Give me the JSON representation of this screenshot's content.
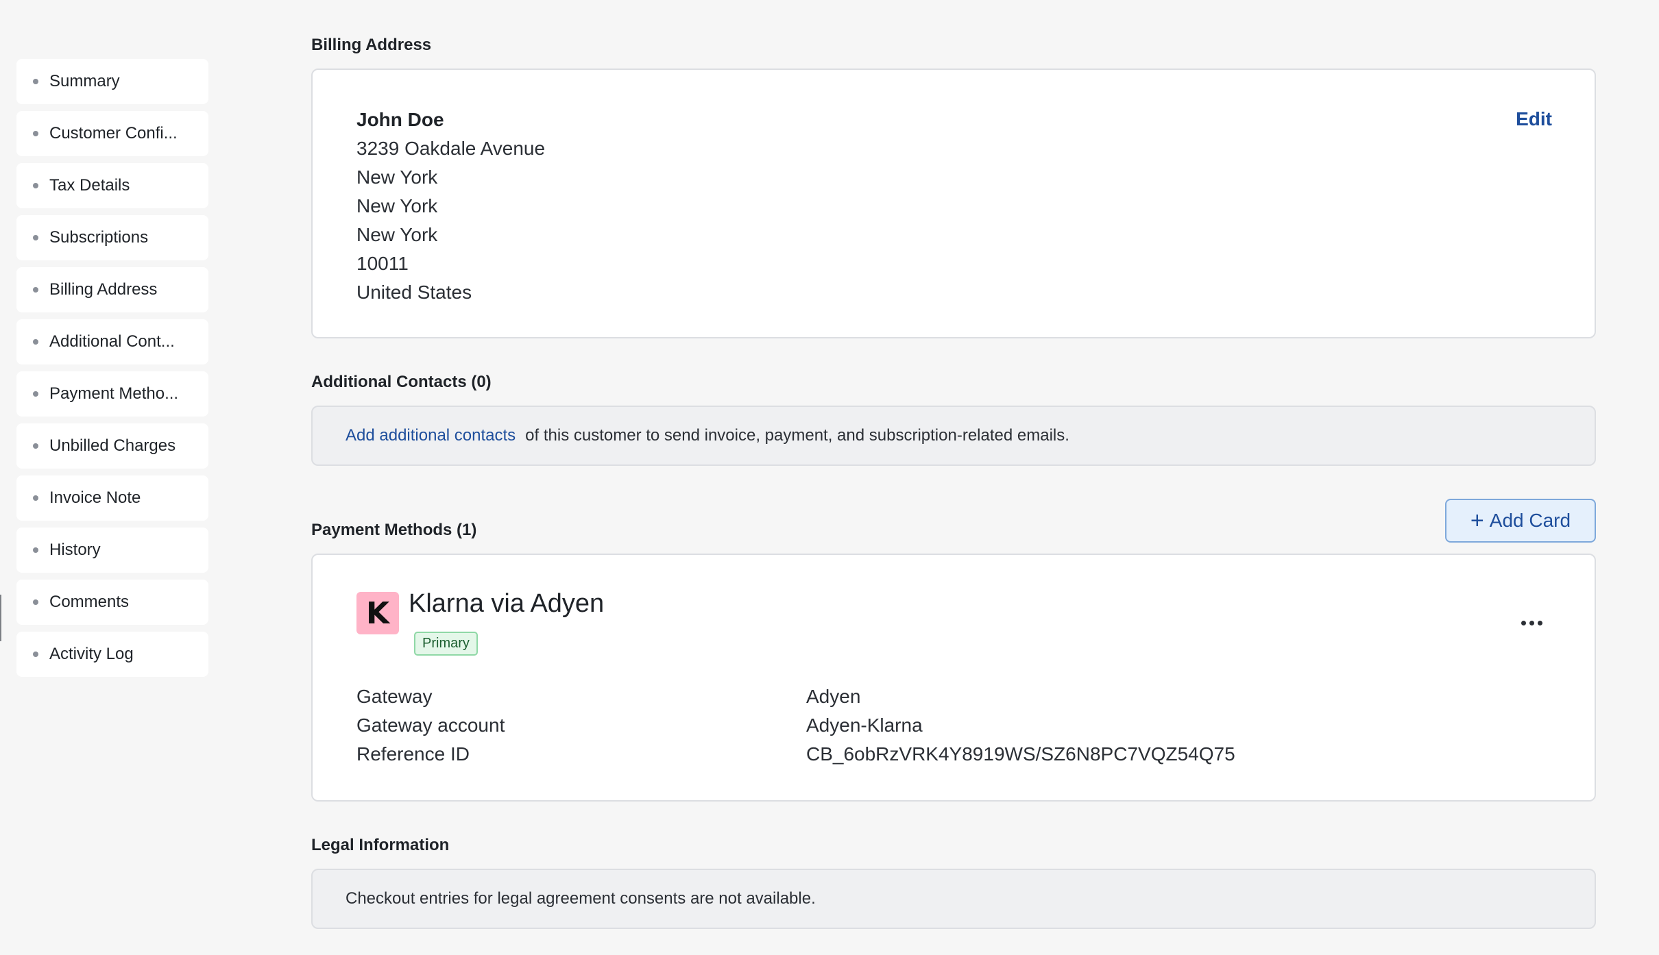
{
  "sidebar": {
    "items": [
      {
        "label": "Summary"
      },
      {
        "label": "Customer Confi..."
      },
      {
        "label": "Tax Details"
      },
      {
        "label": "Subscriptions"
      },
      {
        "label": "Billing Address"
      },
      {
        "label": "Additional Cont..."
      },
      {
        "label": "Payment Metho..."
      },
      {
        "label": "Unbilled Charges"
      },
      {
        "label": "Invoice Note"
      },
      {
        "label": "History"
      },
      {
        "label": "Comments"
      },
      {
        "label": "Activity Log"
      }
    ]
  },
  "billing_address": {
    "title": "Billing Address",
    "edit_label": "Edit",
    "name": "John Doe",
    "lines": [
      "3239 Oakdale Avenue",
      "New York",
      "New York",
      "New York",
      "10011",
      "United States"
    ]
  },
  "additional_contacts": {
    "title": "Additional Contacts (0)",
    "link_text": "Add additional contacts",
    "text": "of this customer to send invoice, payment, and subscription-related emails."
  },
  "payment_methods": {
    "title": "Payment Methods (1)",
    "add_card_label": "Add Card",
    "method": {
      "logo_letter": "K",
      "name": "Klarna via Adyen",
      "badge": "Primary",
      "rows": [
        {
          "key": "Gateway",
          "value": "Adyen"
        },
        {
          "key": "Gateway account",
          "value": "Adyen-Klarna"
        },
        {
          "key": "Reference ID",
          "value": "CB_6obRzVRK4Y8919WS/SZ6N8PC7VQZ54Q75"
        }
      ]
    }
  },
  "legal_information": {
    "title": "Legal Information",
    "text": "Checkout entries for legal agreement consents are not available."
  },
  "colors": {
    "accent": "#1e4e9c",
    "klarna_pink": "#ffb3c7",
    "badge_green": "#1b5e2f"
  },
  "icons": {
    "sidebar_bullet": "dot-icon",
    "add": "plus-icon",
    "more": "more-horizontal-icon"
  }
}
